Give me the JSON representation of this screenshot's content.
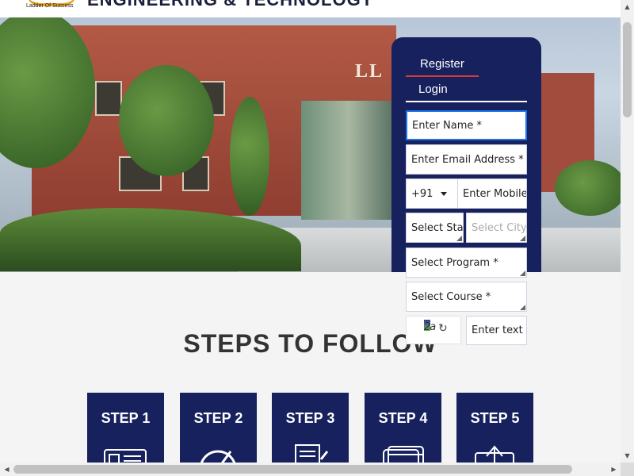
{
  "header": {
    "college_name": "ENGINEERING & TECHNOLOGY",
    "logo_tagline": "Ladder Of Success"
  },
  "hero": {
    "building_sign": "LL"
  },
  "form": {
    "tabs": [
      {
        "label": "Register",
        "active": true
      },
      {
        "label": "Login",
        "active": false
      }
    ],
    "name_placeholder": "Enter Name *",
    "email_placeholder": "Enter Email Address *",
    "country_code": "+91",
    "mobile_placeholder": "Enter Mobile Number *",
    "state_placeholder": "Select State *",
    "city_placeholder": "Select City *",
    "program_placeholder": "Select Program *",
    "course_placeholder": "Select Course *",
    "captcha_text": "2a",
    "captcha_input_placeholder": "Enter text"
  },
  "steps": {
    "title": "STEPS TO FOLLOW",
    "items": [
      {
        "label": "STEP 1",
        "icon": "application-form-icon"
      },
      {
        "label": "STEP 2",
        "icon": "gauge-icon"
      },
      {
        "label": "STEP 3",
        "icon": "document-sign-icon"
      },
      {
        "label": "STEP 4",
        "icon": "payment-card-icon"
      },
      {
        "label": "STEP 5",
        "icon": "upload-icon"
      }
    ]
  },
  "colors": {
    "navy": "#16215e",
    "accent_red": "#d83a3a",
    "logo_gold": "#e6a12a"
  }
}
